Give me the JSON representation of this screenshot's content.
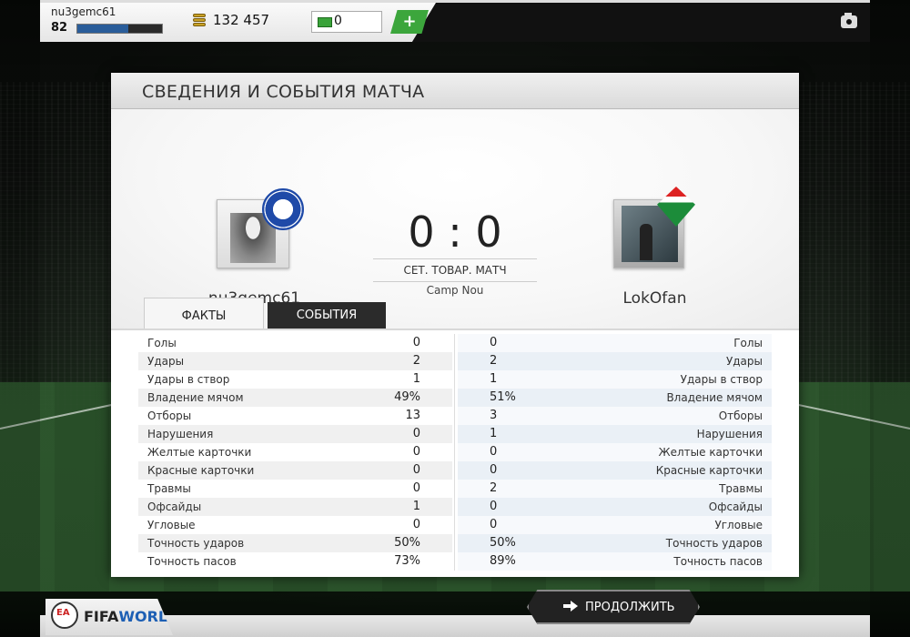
{
  "topbar": {
    "username": "nu3gemc61",
    "level": "82",
    "xp_fraction": 0.6,
    "coins": "132 457",
    "points": "0",
    "add_label": "+"
  },
  "panel": {
    "title": "СВЕДЕНИЯ И СОБЫТИЯ МАТЧА"
  },
  "match": {
    "home_name": "nu3gemc61",
    "away_name": "LokOfan",
    "score": "0 : 0",
    "type": "СЕТ. ТОВАР. МАТЧ",
    "stadium": "Camp Nou"
  },
  "tabs": {
    "facts": "ФАКТЫ",
    "events": "СОБЫТИЯ"
  },
  "stats": [
    {
      "label": "Голы",
      "home": "0",
      "away": "0"
    },
    {
      "label": "Удары",
      "home": "2",
      "away": "2"
    },
    {
      "label": "Удары в створ",
      "home": "1",
      "away": "1"
    },
    {
      "label": "Владение мячом",
      "home": "49%",
      "away": "51%"
    },
    {
      "label": "Отборы",
      "home": "13",
      "away": "3"
    },
    {
      "label": "Нарушения",
      "home": "0",
      "away": "1"
    },
    {
      "label": "Желтые карточки",
      "home": "0",
      "away": "0"
    },
    {
      "label": "Красные карточки",
      "home": "0",
      "away": "0"
    },
    {
      "label": "Травмы",
      "home": "0",
      "away": "2"
    },
    {
      "label": "Офсайды",
      "home": "1",
      "away": "0"
    },
    {
      "label": "Угловые",
      "home": "0",
      "away": "0"
    },
    {
      "label": "Точность ударов",
      "home": "50%",
      "away": "50%"
    },
    {
      "label": "Точность пасов",
      "home": "73%",
      "away": "89%"
    }
  ],
  "footer": {
    "logo_ea": "EA",
    "logo_fifa": "FIFA",
    "logo_world": "WORLD",
    "continue_label": "ПРОДОЛЖИТЬ"
  },
  "colors": {
    "accent_green": "#3ca63c",
    "xp_blue": "#2a5d9a",
    "dark_tab": "#2b2b2b"
  }
}
